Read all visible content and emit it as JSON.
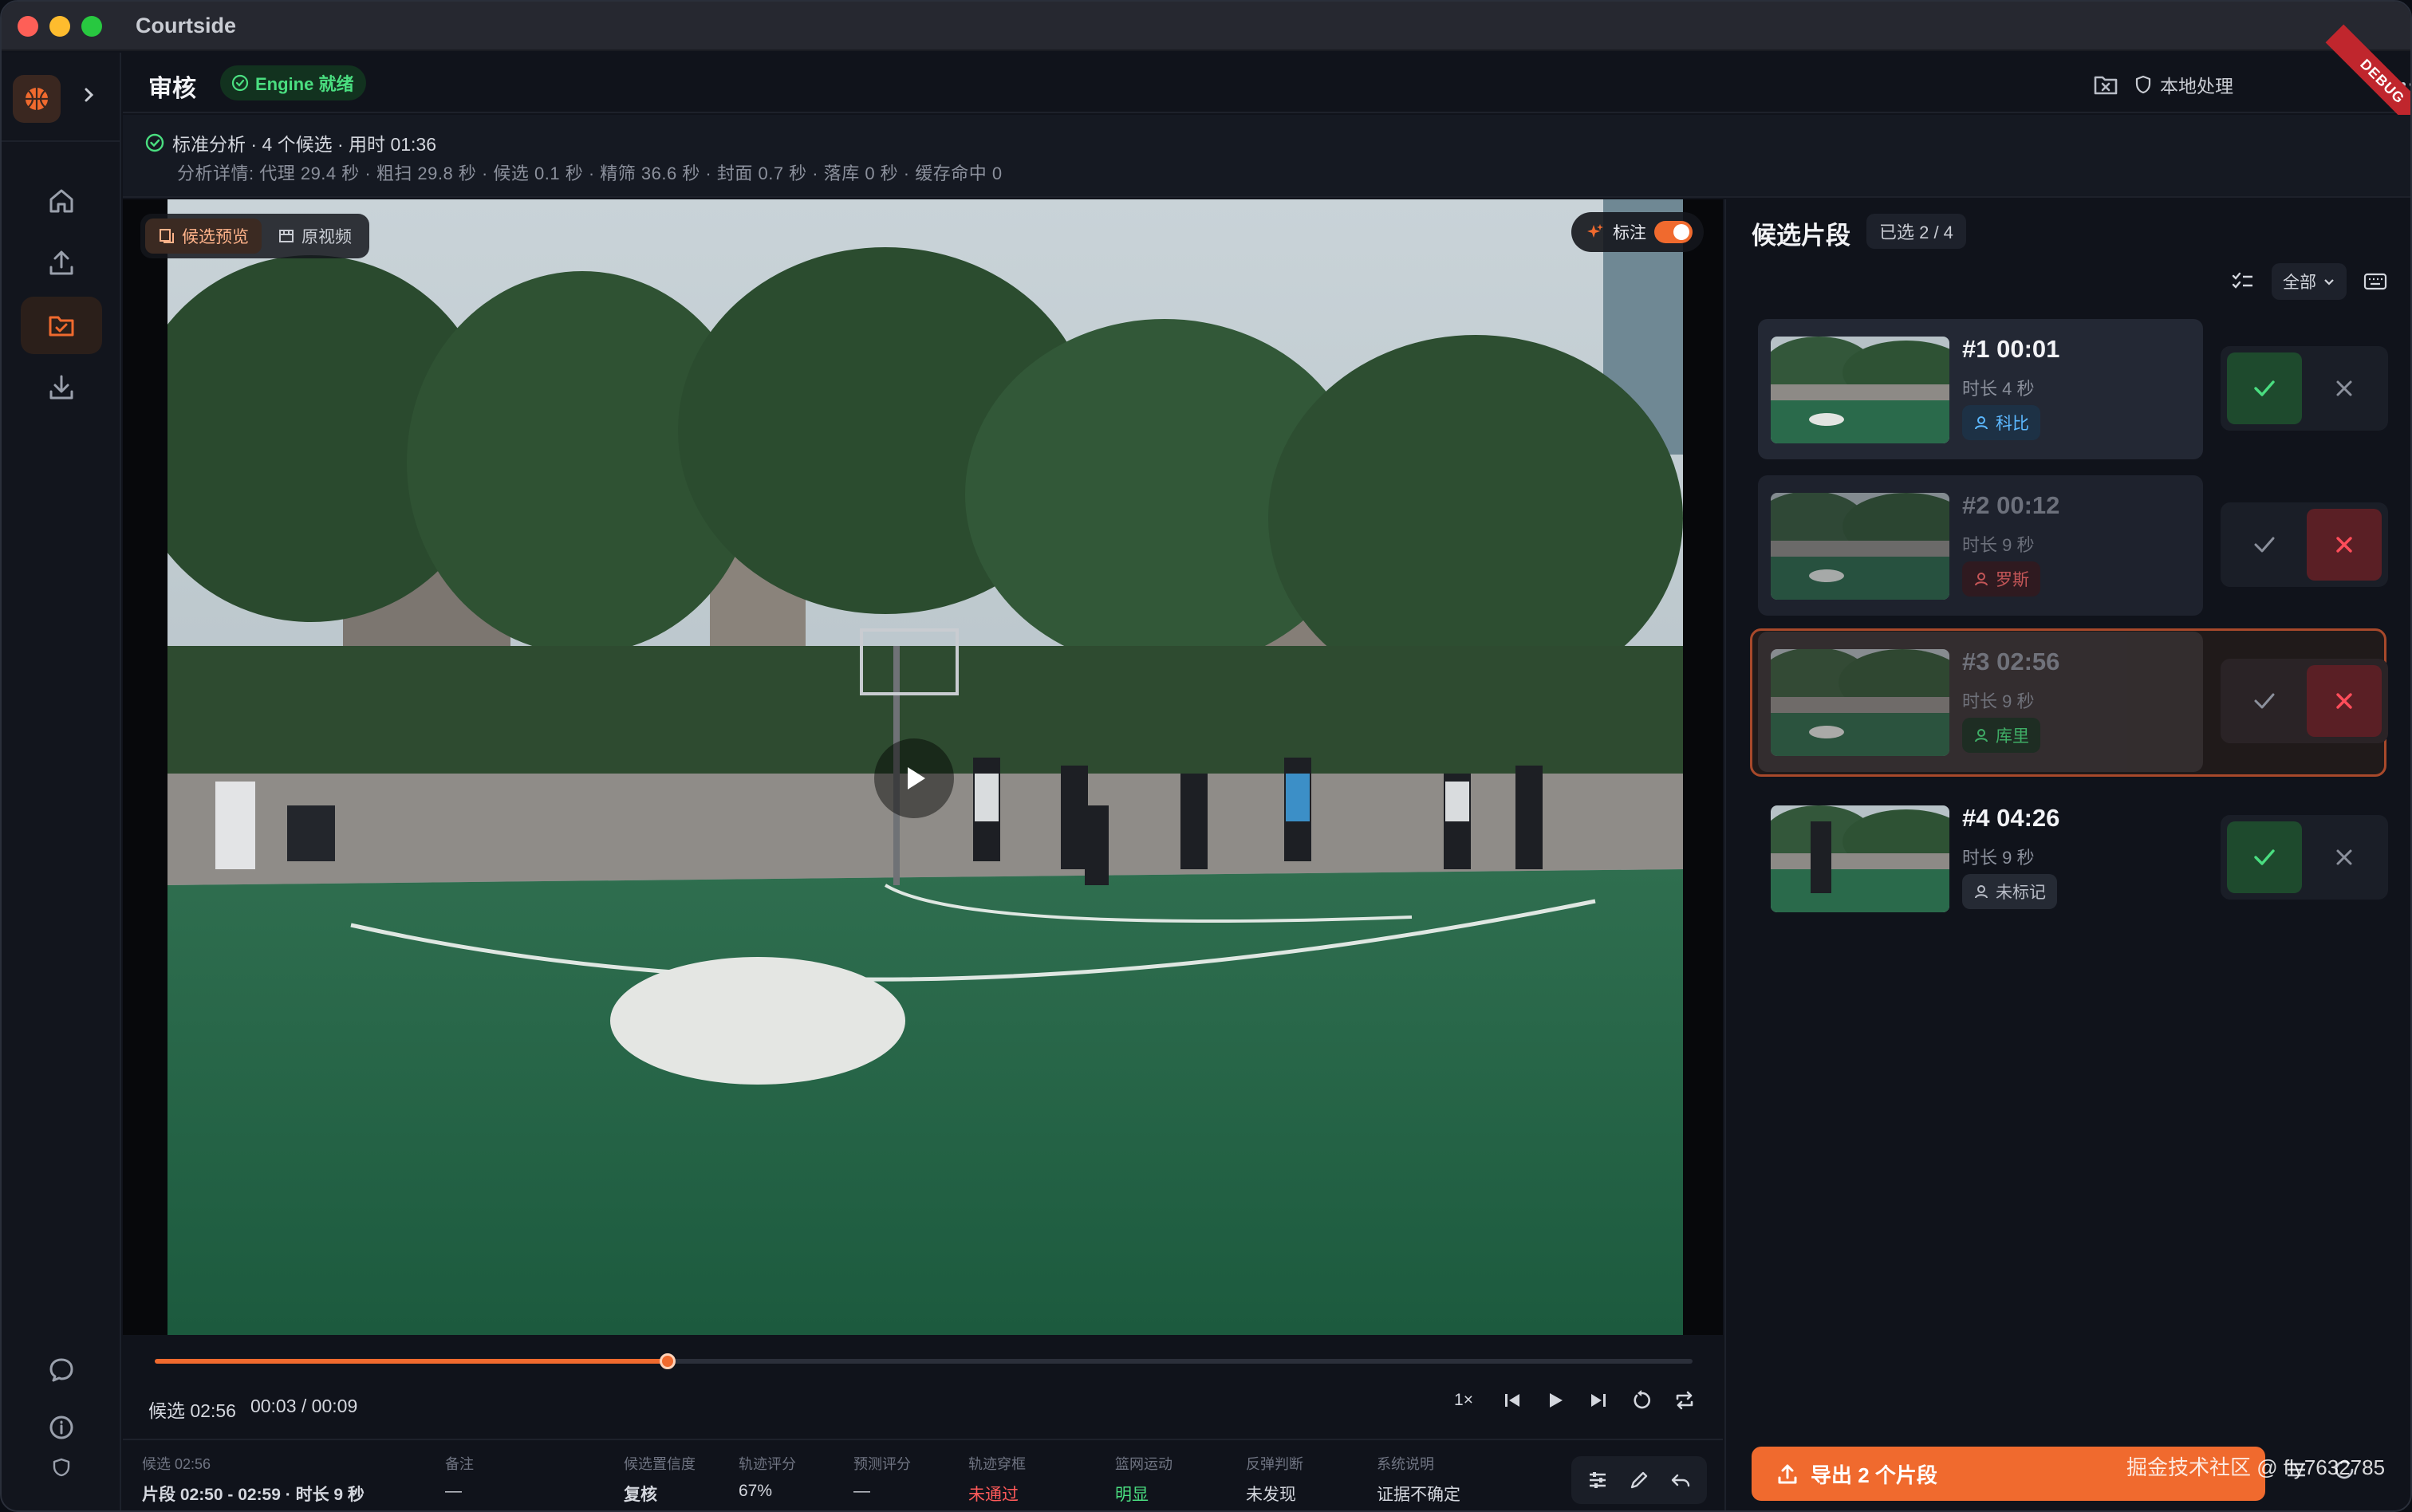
{
  "app": {
    "title": "Courtside"
  },
  "header": {
    "page_title": "审核",
    "engine_status": "Engine 就绪",
    "local_label": "本地处理",
    "debug_ribbon": "DEBUG"
  },
  "analysis": {
    "summary": "标准分析 · 4 个候选 · 用时 01:36",
    "details": "分析详情: 代理 29.4 秒 · 粗扫 29.8 秒 · 候选 0.1 秒 · 精筛 36.6 秒 · 封面 0.7 秒 · 落库 0 秒 · 缓存命中 0"
  },
  "video": {
    "mode_candidate": "候选预览",
    "mode_original": "原视频",
    "annotate_label": "标注",
    "annotate_on": true
  },
  "timeline": {
    "clip_label": "候选 02:56",
    "position": "00:03 / 00:09",
    "progress": 0.3333,
    "speed": "1×"
  },
  "stats": [
    {
      "label": "候选 02:56",
      "value": "片段 02:50 - 02:59 · 时长 9 秒",
      "tone": "strong"
    },
    {
      "label": "备注",
      "value": "—",
      "tone": "normal"
    },
    {
      "label": "候选置信度",
      "value": "复核",
      "tone": "strong"
    },
    {
      "label": "轨迹评分",
      "value": "67%",
      "tone": "normal"
    },
    {
      "label": "预测评分",
      "value": "—",
      "tone": "normal"
    },
    {
      "label": "轨迹穿框",
      "value": "未通过",
      "tone": "red"
    },
    {
      "label": "篮网运动",
      "value": "明显",
      "tone": "green"
    },
    {
      "label": "反弹判断",
      "value": "未发现",
      "tone": "normal"
    },
    {
      "label": "系统说明",
      "value": "证据不确定",
      "tone": "normal"
    }
  ],
  "panel": {
    "title": "候选片段",
    "selected": "已选 2 / 4",
    "filter": "全部",
    "candidates": [
      {
        "title": "#1 00:01",
        "duration": "时长 4 秒",
        "tag": "科比",
        "tag_color": "blue",
        "decision": "accept",
        "current": false
      },
      {
        "title": "#2 00:12",
        "duration": "时长 9 秒",
        "tag": "罗斯",
        "tag_color": "red",
        "decision": "reject",
        "current": false
      },
      {
        "title": "#3 02:56",
        "duration": "时长 9 秒",
        "tag": "库里",
        "tag_color": "green",
        "decision": "reject",
        "current": true
      },
      {
        "title": "#4 04:26",
        "duration": "时长 9 秒",
        "tag": "未标记",
        "tag_color": "gray",
        "decision": "accept",
        "current": false
      }
    ]
  },
  "export": {
    "label": "导出 2 个片段"
  },
  "watermark": "掘金技术社区 @ fly7632785",
  "colors": {
    "accent": "#f06a2e",
    "success": "#4ade80",
    "danger": "#ff5a5a"
  }
}
